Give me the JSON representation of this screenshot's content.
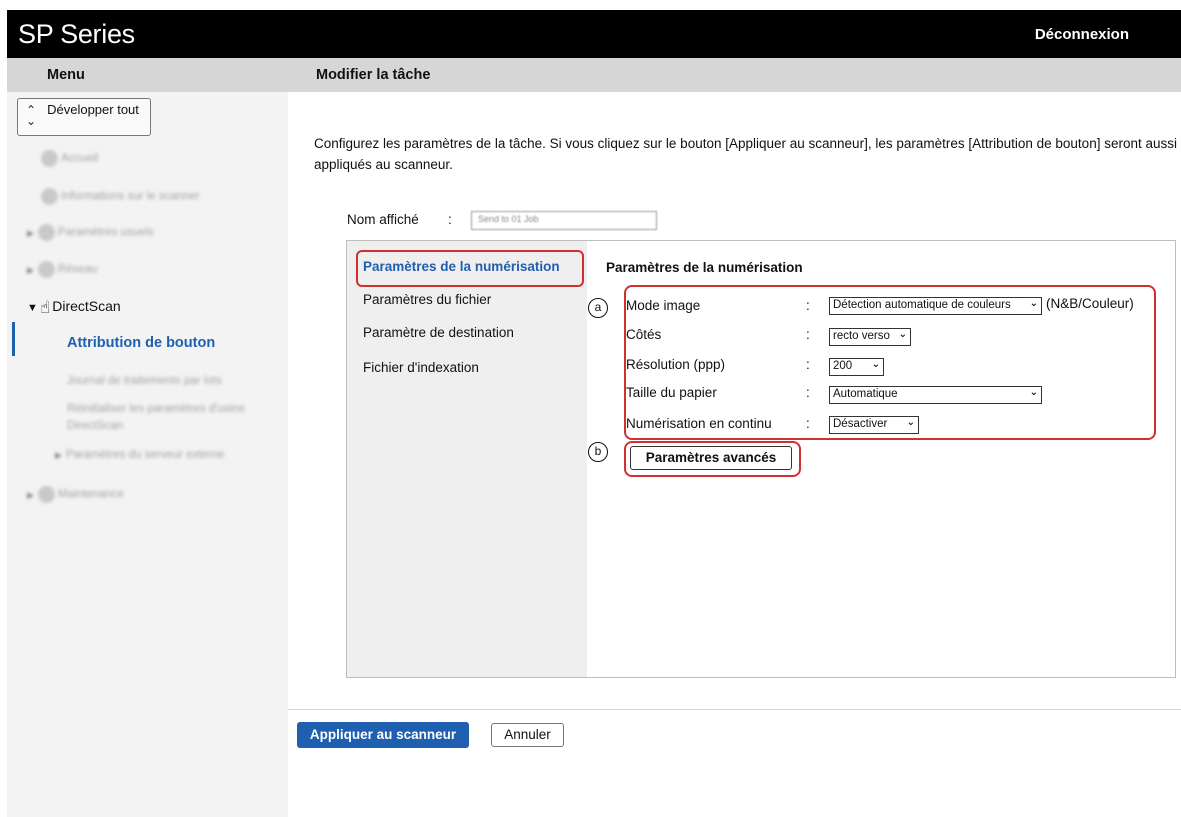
{
  "header": {
    "brand": "SP Series",
    "logout": "Déconnexion"
  },
  "subheader": {
    "menu_title": "Menu",
    "page_title": "Modifier la tâche"
  },
  "sidebar": {
    "expand_all": "Développer tout",
    "items": [
      {
        "label": "Accueil"
      },
      {
        "label": "Informations sur le scanner"
      },
      {
        "label": "Paramètres usuels"
      },
      {
        "label": "Réseau"
      },
      {
        "label": "DirectScan"
      },
      {
        "label": "Attribution de bouton"
      },
      {
        "label": "Journal de traitements par lots"
      },
      {
        "label": "Réinitialiser les paramètres d'usine DirectScan"
      },
      {
        "label": "Paramètres du serveur externe"
      },
      {
        "label": "Maintenance"
      }
    ]
  },
  "main": {
    "intro": "Configurez les paramètres de la tâche. Si vous cliquez sur le bouton [Appliquer au scanneur], les paramètres [Attribution de bouton] seront aussi appliqués au scanneur.",
    "name_label": "Nom affiché",
    "name_colon": ":",
    "name_value": "Send to 01 Job",
    "tabs": [
      {
        "label": "Paramètres de la numérisation"
      },
      {
        "label": "Paramètres du fichier"
      },
      {
        "label": "Paramètre de destination"
      },
      {
        "label": "Fichier d'indexation"
      }
    ],
    "section_title": "Paramètres de la numérisation",
    "markers": {
      "a": "a",
      "b": "b"
    },
    "rows": [
      {
        "label": "Mode image",
        "colon": ":",
        "value": "Détection automatique de couleurs",
        "suffix": "(N&B/Couleur)"
      },
      {
        "label": "Côtés",
        "colon": ":",
        "value": "recto verso"
      },
      {
        "label": "Résolution (ppp)",
        "colon": ":",
        "value": "200"
      },
      {
        "label": "Taille du papier",
        "colon": ":",
        "value": "Automatique"
      },
      {
        "label": "Numérisation en continu",
        "colon": ":",
        "value": "Désactiver"
      }
    ],
    "advanced_button": "Paramètres avancés",
    "apply_button": "Appliquer au scanneur",
    "cancel_button": "Annuler"
  },
  "colors": {
    "accent": "#1f5fb0",
    "highlight": "#d0302f",
    "header_bg": "#000000",
    "subheader_bg": "#d6d6d6"
  }
}
